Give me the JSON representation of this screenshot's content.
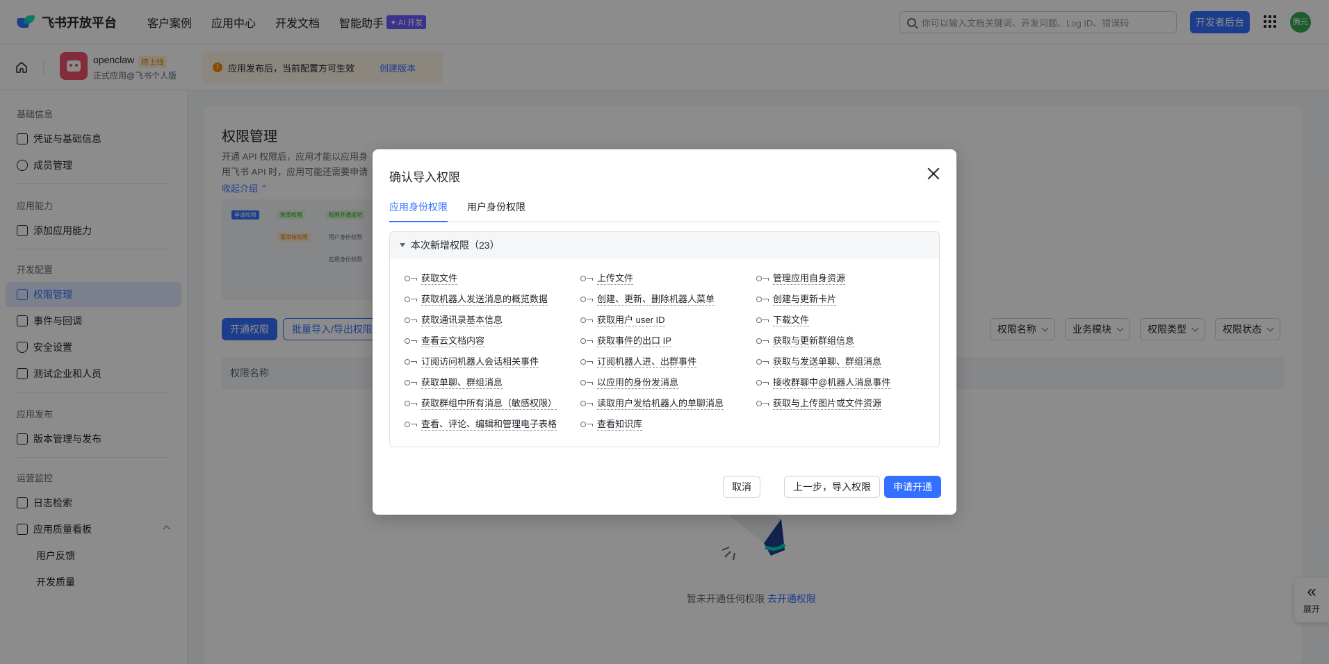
{
  "topbar": {
    "logo_text": "飞书开放平台",
    "nav": [
      "客户案例",
      "应用中心",
      "开发文档",
      "智能助手"
    ],
    "ai_badge": "✦ AI 开发",
    "search_placeholder": "你可以输入文档关键词、开发问题、Log ID、错误码",
    "dev_console": "开发者后台",
    "avatar_text": "腾元"
  },
  "appbar": {
    "app_name": "openclaw",
    "status_badge": "待上线",
    "app_sub": "正式应用@飞书个人版",
    "notice": "应用发布后，当前配置方可生效",
    "notice_link": "创建版本"
  },
  "sidebar": {
    "sections": [
      {
        "title": "基础信息",
        "items": [
          "凭证与基础信息",
          "成员管理"
        ]
      },
      {
        "title": "应用能力",
        "items": [
          "添加应用能力"
        ]
      },
      {
        "title": "开发配置",
        "items": [
          "权限管理",
          "事件与回调",
          "安全设置",
          "测试企业和人员"
        ]
      },
      {
        "title": "应用发布",
        "items": [
          "版本管理与发布"
        ]
      },
      {
        "title": "运营监控",
        "items": [
          "日志检索",
          "应用质量看板",
          "用户反馈",
          "开发质量"
        ]
      }
    ]
  },
  "main": {
    "title": "权限管理",
    "desc_line1": "开通 API 权限后，应用才能以应用身",
    "desc_line2": "用飞书 API 时，应用可能还需要申请",
    "collapse": "收起介绍 ⌃",
    "diagram_labels": [
      "申请权限",
      "免审权限",
      "权限开通成功",
      "需审核权限",
      "用户身份权限",
      "应用身份权限"
    ],
    "btn_open": "开通权限",
    "btn_batch": "批量导入/导出权限",
    "filters": [
      "权限名称",
      "业务模块",
      "权限类型",
      "权限状态"
    ],
    "table_col": "权限名称",
    "empty_text": "暂未开通任何权限",
    "empty_link": "去开通权限"
  },
  "expand": {
    "arrows": "«",
    "label": "展开"
  },
  "modal": {
    "title": "确认导入权限",
    "tabs": [
      "应用身份权限",
      "用户身份权限"
    ],
    "section_title": "本次新增权限（23）",
    "permissions": [
      "获取文件",
      "上传文件",
      "管理应用自身资源",
      "获取机器人发送消息的概览数据",
      "创建、更新、删除机器人菜单",
      "创建与更新卡片",
      "获取通讯录基本信息",
      "获取用户 user ID",
      "下载文件",
      "查看云文档内容",
      "获取事件的出口 IP",
      "获取与更新群组信息",
      "订阅访问机器人会话相关事件",
      "订阅机器人进、出群事件",
      "获取与发送单聊、群组消息",
      "获取单聊、群组消息",
      "以应用的身份发消息",
      "接收群聊中@机器人消息事件",
      "获取群组中所有消息（敏感权限）",
      "读取用户发给机器人的单聊消息",
      "获取与上传图片或文件资源",
      "查看、评论、编辑和管理电子表格",
      "查看知识库"
    ],
    "footer": {
      "cancel": "取消",
      "prev": "上一步，导入权限",
      "apply": "申请开通"
    }
  }
}
